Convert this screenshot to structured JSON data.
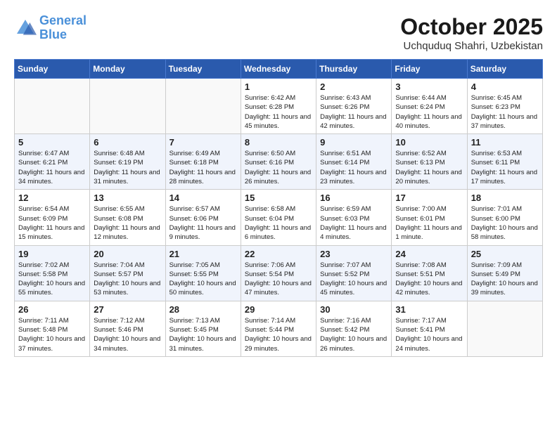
{
  "header": {
    "logo_line1": "General",
    "logo_line2": "Blue",
    "month": "October 2025",
    "location": "Uchquduq Shahri, Uzbekistan"
  },
  "weekdays": [
    "Sunday",
    "Monday",
    "Tuesday",
    "Wednesday",
    "Thursday",
    "Friday",
    "Saturday"
  ],
  "weeks": [
    [
      {
        "day": "",
        "sunrise": "",
        "sunset": "",
        "daylight": ""
      },
      {
        "day": "",
        "sunrise": "",
        "sunset": "",
        "daylight": ""
      },
      {
        "day": "",
        "sunrise": "",
        "sunset": "",
        "daylight": ""
      },
      {
        "day": "1",
        "sunrise": "Sunrise: 6:42 AM",
        "sunset": "Sunset: 6:28 PM",
        "daylight": "Daylight: 11 hours and 45 minutes."
      },
      {
        "day": "2",
        "sunrise": "Sunrise: 6:43 AM",
        "sunset": "Sunset: 6:26 PM",
        "daylight": "Daylight: 11 hours and 42 minutes."
      },
      {
        "day": "3",
        "sunrise": "Sunrise: 6:44 AM",
        "sunset": "Sunset: 6:24 PM",
        "daylight": "Daylight: 11 hours and 40 minutes."
      },
      {
        "day": "4",
        "sunrise": "Sunrise: 6:45 AM",
        "sunset": "Sunset: 6:23 PM",
        "daylight": "Daylight: 11 hours and 37 minutes."
      }
    ],
    [
      {
        "day": "5",
        "sunrise": "Sunrise: 6:47 AM",
        "sunset": "Sunset: 6:21 PM",
        "daylight": "Daylight: 11 hours and 34 minutes."
      },
      {
        "day": "6",
        "sunrise": "Sunrise: 6:48 AM",
        "sunset": "Sunset: 6:19 PM",
        "daylight": "Daylight: 11 hours and 31 minutes."
      },
      {
        "day": "7",
        "sunrise": "Sunrise: 6:49 AM",
        "sunset": "Sunset: 6:18 PM",
        "daylight": "Daylight: 11 hours and 28 minutes."
      },
      {
        "day": "8",
        "sunrise": "Sunrise: 6:50 AM",
        "sunset": "Sunset: 6:16 PM",
        "daylight": "Daylight: 11 hours and 26 minutes."
      },
      {
        "day": "9",
        "sunrise": "Sunrise: 6:51 AM",
        "sunset": "Sunset: 6:14 PM",
        "daylight": "Daylight: 11 hours and 23 minutes."
      },
      {
        "day": "10",
        "sunrise": "Sunrise: 6:52 AM",
        "sunset": "Sunset: 6:13 PM",
        "daylight": "Daylight: 11 hours and 20 minutes."
      },
      {
        "day": "11",
        "sunrise": "Sunrise: 6:53 AM",
        "sunset": "Sunset: 6:11 PM",
        "daylight": "Daylight: 11 hours and 17 minutes."
      }
    ],
    [
      {
        "day": "12",
        "sunrise": "Sunrise: 6:54 AM",
        "sunset": "Sunset: 6:09 PM",
        "daylight": "Daylight: 11 hours and 15 minutes."
      },
      {
        "day": "13",
        "sunrise": "Sunrise: 6:55 AM",
        "sunset": "Sunset: 6:08 PM",
        "daylight": "Daylight: 11 hours and 12 minutes."
      },
      {
        "day": "14",
        "sunrise": "Sunrise: 6:57 AM",
        "sunset": "Sunset: 6:06 PM",
        "daylight": "Daylight: 11 hours and 9 minutes."
      },
      {
        "day": "15",
        "sunrise": "Sunrise: 6:58 AM",
        "sunset": "Sunset: 6:04 PM",
        "daylight": "Daylight: 11 hours and 6 minutes."
      },
      {
        "day": "16",
        "sunrise": "Sunrise: 6:59 AM",
        "sunset": "Sunset: 6:03 PM",
        "daylight": "Daylight: 11 hours and 4 minutes."
      },
      {
        "day": "17",
        "sunrise": "Sunrise: 7:00 AM",
        "sunset": "Sunset: 6:01 PM",
        "daylight": "Daylight: 11 hours and 1 minute."
      },
      {
        "day": "18",
        "sunrise": "Sunrise: 7:01 AM",
        "sunset": "Sunset: 6:00 PM",
        "daylight": "Daylight: 10 hours and 58 minutes."
      }
    ],
    [
      {
        "day": "19",
        "sunrise": "Sunrise: 7:02 AM",
        "sunset": "Sunset: 5:58 PM",
        "daylight": "Daylight: 10 hours and 55 minutes."
      },
      {
        "day": "20",
        "sunrise": "Sunrise: 7:04 AM",
        "sunset": "Sunset: 5:57 PM",
        "daylight": "Daylight: 10 hours and 53 minutes."
      },
      {
        "day": "21",
        "sunrise": "Sunrise: 7:05 AM",
        "sunset": "Sunset: 5:55 PM",
        "daylight": "Daylight: 10 hours and 50 minutes."
      },
      {
        "day": "22",
        "sunrise": "Sunrise: 7:06 AM",
        "sunset": "Sunset: 5:54 PM",
        "daylight": "Daylight: 10 hours and 47 minutes."
      },
      {
        "day": "23",
        "sunrise": "Sunrise: 7:07 AM",
        "sunset": "Sunset: 5:52 PM",
        "daylight": "Daylight: 10 hours and 45 minutes."
      },
      {
        "day": "24",
        "sunrise": "Sunrise: 7:08 AM",
        "sunset": "Sunset: 5:51 PM",
        "daylight": "Daylight: 10 hours and 42 minutes."
      },
      {
        "day": "25",
        "sunrise": "Sunrise: 7:09 AM",
        "sunset": "Sunset: 5:49 PM",
        "daylight": "Daylight: 10 hours and 39 minutes."
      }
    ],
    [
      {
        "day": "26",
        "sunrise": "Sunrise: 7:11 AM",
        "sunset": "Sunset: 5:48 PM",
        "daylight": "Daylight: 10 hours and 37 minutes."
      },
      {
        "day": "27",
        "sunrise": "Sunrise: 7:12 AM",
        "sunset": "Sunset: 5:46 PM",
        "daylight": "Daylight: 10 hours and 34 minutes."
      },
      {
        "day": "28",
        "sunrise": "Sunrise: 7:13 AM",
        "sunset": "Sunset: 5:45 PM",
        "daylight": "Daylight: 10 hours and 31 minutes."
      },
      {
        "day": "29",
        "sunrise": "Sunrise: 7:14 AM",
        "sunset": "Sunset: 5:44 PM",
        "daylight": "Daylight: 10 hours and 29 minutes."
      },
      {
        "day": "30",
        "sunrise": "Sunrise: 7:16 AM",
        "sunset": "Sunset: 5:42 PM",
        "daylight": "Daylight: 10 hours and 26 minutes."
      },
      {
        "day": "31",
        "sunrise": "Sunrise: 7:17 AM",
        "sunset": "Sunset: 5:41 PM",
        "daylight": "Daylight: 10 hours and 24 minutes."
      },
      {
        "day": "",
        "sunrise": "",
        "sunset": "",
        "daylight": ""
      }
    ]
  ]
}
